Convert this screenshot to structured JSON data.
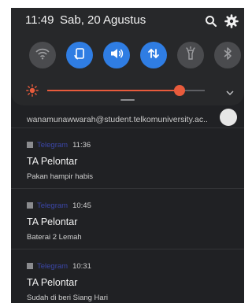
{
  "status": {
    "time": "11:49",
    "date": "Sab, 20 Agustus",
    "search_icon": "search-icon",
    "settings_icon": "gear-icon"
  },
  "quick_tiles": [
    {
      "name": "wifi",
      "icon": "wifi-icon",
      "state": "off"
    },
    {
      "name": "auto-rotate",
      "icon": "rotate-icon",
      "state": "on"
    },
    {
      "name": "sound",
      "icon": "volume-icon",
      "state": "on"
    },
    {
      "name": "mobile-data",
      "icon": "data-transfer-icon",
      "state": "on"
    },
    {
      "name": "flashlight",
      "icon": "flashlight-icon",
      "state": "off"
    },
    {
      "name": "bluetooth",
      "icon": "bluetooth-icon",
      "state": "off"
    }
  ],
  "brightness": {
    "level": 0.84,
    "icon": "sun-icon"
  },
  "colors": {
    "accent": "#2f7de3",
    "brightness": "#e85b3c",
    "app_name": "#3b47a8"
  },
  "account": {
    "email": "wanamunawwarah@student.telkomuniversity.ac.."
  },
  "notifications": [
    {
      "app": "Telegram",
      "time": "11:36",
      "title": "TA Pelontar",
      "body": "Pakan hampir habis"
    },
    {
      "app": "Telegram",
      "time": "10:45",
      "title": "TA Pelontar",
      "body": "Baterai 2 Lemah"
    },
    {
      "app": "Telegram",
      "time": "10:31",
      "title": "TA Pelontar",
      "body": "Sudah di beri Siang Hari"
    }
  ]
}
